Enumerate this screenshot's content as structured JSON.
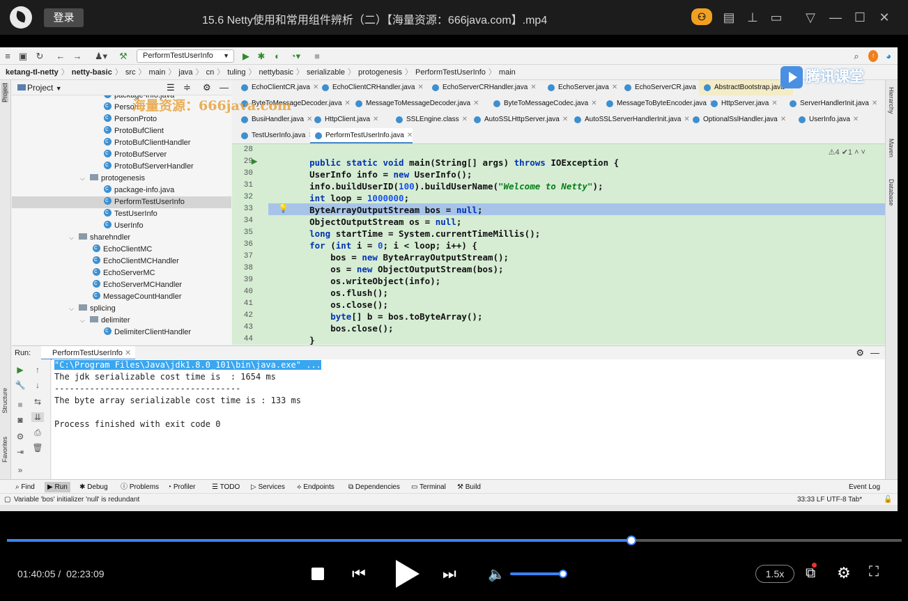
{
  "player": {
    "login_label": "登录",
    "video_title": "15.6 Netty使用和常用组件辨析（二）【海量资源：666java.com】.mp4",
    "current_time": "01:40:05 /",
    "total_time": "02:23:09",
    "speed": "1.5x",
    "progress_fraction": 0.698,
    "volume_fraction": 0.9
  },
  "ide": {
    "run_config": "PerformTestUserInfo",
    "breadcrumb": [
      "ketang-tl-netty",
      "netty-basic",
      "src",
      "main",
      "java",
      "cn",
      "tuling",
      "nettybasic",
      "serializable",
      "protogenesis",
      "PerformTestUserInfo",
      "main"
    ],
    "project_label": "Project",
    "tree": [
      {
        "label": "package-info.java",
        "type": "class",
        "indent": 3
      },
      {
        "label": "Person",
        "type": "class",
        "indent": 3
      },
      {
        "label": "PersonProto",
        "type": "class",
        "indent": 3
      },
      {
        "label": "ProtoBufClient",
        "type": "class",
        "indent": 3
      },
      {
        "label": "ProtoBufClientHandler",
        "type": "class",
        "indent": 3
      },
      {
        "label": "ProtoBufServer",
        "type": "class",
        "indent": 3
      },
      {
        "label": "ProtoBufServerHandler",
        "type": "class",
        "indent": 3
      },
      {
        "label": "protogenesis",
        "type": "folder",
        "indent": 2
      },
      {
        "label": "package-info.java",
        "type": "class",
        "indent": 3
      },
      {
        "label": "PerformTestUserInfo",
        "type": "class",
        "indent": 3,
        "selected": true
      },
      {
        "label": "TestUserInfo",
        "type": "class",
        "indent": 3
      },
      {
        "label": "UserInfo",
        "type": "class",
        "indent": 3
      },
      {
        "label": "sharehndler",
        "type": "folder",
        "indent": 1
      },
      {
        "label": "EchoClientMC",
        "type": "class",
        "indent": 2
      },
      {
        "label": "EchoClientMCHandler",
        "type": "class",
        "indent": 2
      },
      {
        "label": "EchoServerMC",
        "type": "class",
        "indent": 2
      },
      {
        "label": "EchoServerMCHandler",
        "type": "class",
        "indent": 2
      },
      {
        "label": "MessageCountHandler",
        "type": "class",
        "indent": 2
      },
      {
        "label": "splicing",
        "type": "folder",
        "indent": 1
      },
      {
        "label": "delimiter",
        "type": "folder",
        "indent": 2
      },
      {
        "label": "DelimiterClientHandler",
        "type": "class",
        "indent": 3
      }
    ],
    "tab_rows": [
      [
        "EchoClientCR.java",
        "EchoClientCRHandler.java",
        "EchoServerCRHandler.java",
        "EchoServer.java",
        "EchoServerCR.java",
        "AbstractBootstrap.java"
      ],
      [
        "ByteToMessageDecoder.java",
        "MessageToMessageDecoder.java",
        "ByteToMessageCodec.java",
        "MessageToByteEncoder.java",
        "HttpServer.java",
        "ServerHandlerInit.java"
      ],
      [
        "BusiHandler.java",
        "HttpClient.java",
        "SSLEngine.class",
        "AutoSSLHttpServer.java",
        "AutoSSLServerHandlerInit.java",
        "OptionalSslHandler.java",
        "UserInfo.java"
      ],
      [
        "TestUserInfo.java",
        "PerformTestUserInfo.java"
      ]
    ],
    "editor_status": "⚠4 ✔1 ˄ ˅",
    "code_lines": [
      {
        "n": "28",
        "t": ""
      },
      {
        "n": "29",
        "t": "    public static void main(String[] args) throws IOException {"
      },
      {
        "n": "30",
        "t": "    UserInfo info = new UserInfo();"
      },
      {
        "n": "31",
        "t": "    info.buildUserID(100).buildUserName(\"Welcome to Netty\");"
      },
      {
        "n": "32",
        "t": "    int loop = 1000000;"
      },
      {
        "n": "33",
        "t": "    ByteArrayOutputStream bos = null;"
      },
      {
        "n": "34",
        "t": "    ObjectOutputStream os = null;"
      },
      {
        "n": "35",
        "t": "    long startTime = System.currentTimeMillis();"
      },
      {
        "n": "36",
        "t": "    for (int i = 0; i < loop; i++) {"
      },
      {
        "n": "37",
        "t": "        bos = new ByteArrayOutputStream();"
      },
      {
        "n": "38",
        "t": "        os = new ObjectOutputStream(bos);"
      },
      {
        "n": "39",
        "t": "        os.writeObject(info);"
      },
      {
        "n": "40",
        "t": "        os.flush();"
      },
      {
        "n": "41",
        "t": "        os.close();"
      },
      {
        "n": "42",
        "t": "        byte[] b = bos.toByteArray();"
      },
      {
        "n": "43",
        "t": "        bos.close();"
      },
      {
        "n": "44",
        "t": "    }"
      }
    ],
    "run_label": "Run:",
    "run_tab": "PerformTestUserInfo",
    "console": [
      "\"C:\\Program Files\\Java\\jdk1.8.0_101\\bin\\java.exe\" ...",
      "The jdk serializable cost time is  : 1654 ms",
      "-------------------------------------",
      "The byte array serializable cost time is : 133 ms",
      "",
      "Process finished with exit code 0"
    ],
    "bottom_tools": [
      "Find",
      "Run",
      "Debug",
      "Problems",
      "Profiler",
      "TODO",
      "Services",
      "Endpoints",
      "Dependencies",
      "Terminal",
      "Build"
    ],
    "event_log": "Event Log",
    "status_message": "Variable 'bos' initializer 'null' is redundant",
    "status_right": "33:33  LF  UTF-8  Tab*",
    "left_labels": [
      "Project",
      "Structure",
      "Favorites"
    ],
    "right_labels": [
      "Hierarchy",
      "Maven",
      "Database"
    ]
  },
  "watermarks": {
    "left": "海量资源：666java.com",
    "right": "腾讯课堂"
  }
}
